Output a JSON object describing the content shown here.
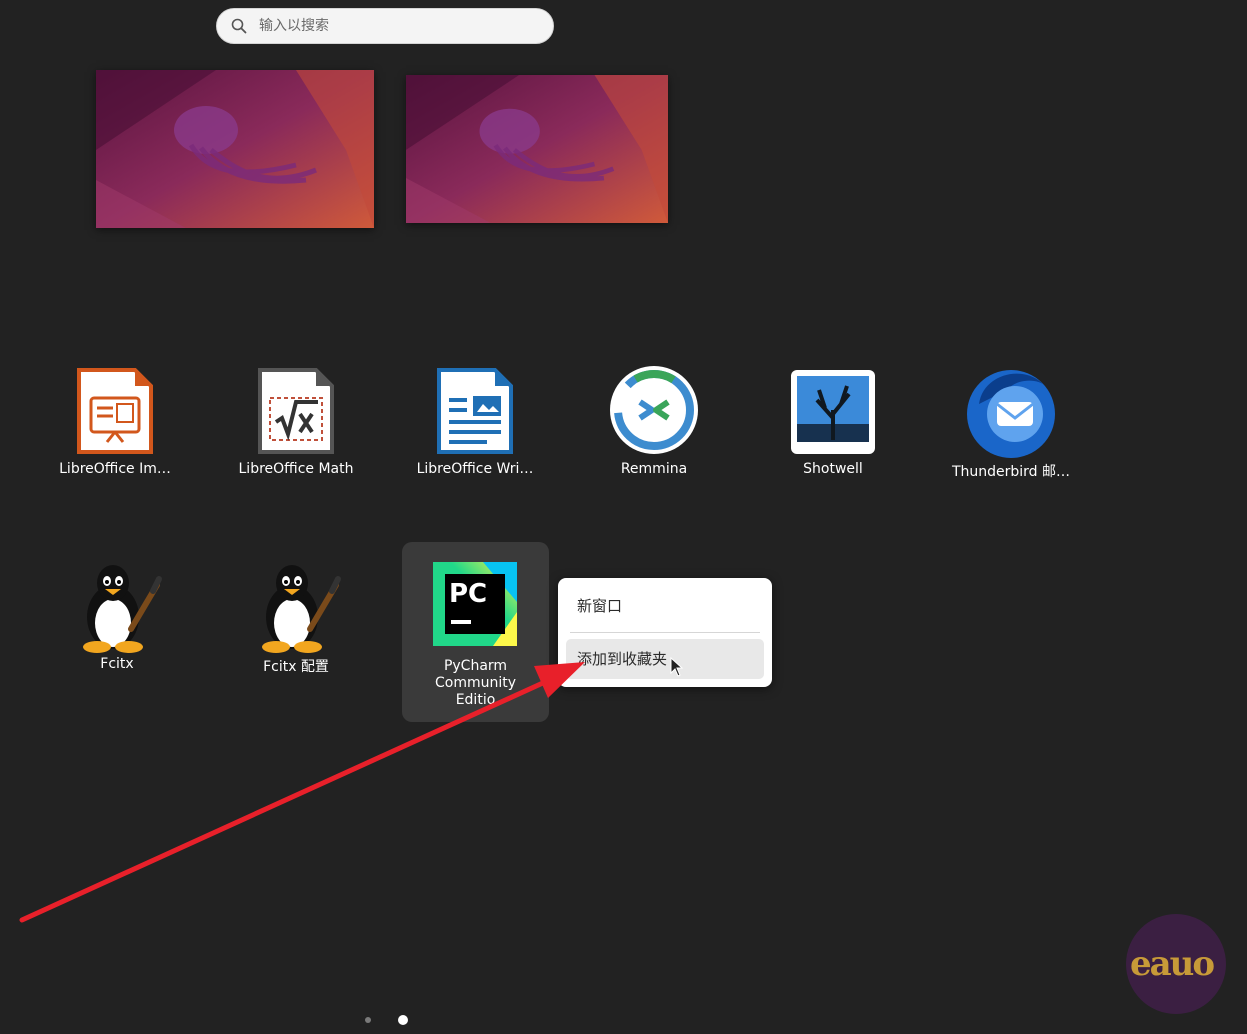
{
  "search": {
    "placeholder": "输入以搜索",
    "icon": "search-icon"
  },
  "workspaces": [
    {
      "name": "workspace-1"
    },
    {
      "name": "workspace-2"
    }
  ],
  "apps_row1": [
    {
      "label": "LibreOffice Im…",
      "icon": "libreoffice-impress-icon"
    },
    {
      "label": "LibreOffice Math",
      "icon": "libreoffice-math-icon"
    },
    {
      "label": "LibreOffice Wri…",
      "icon": "libreoffice-writer-icon"
    },
    {
      "label": "Remmina",
      "icon": "remmina-icon"
    },
    {
      "label": "Shotwell",
      "icon": "shotwell-icon"
    },
    {
      "label": "Thunderbird 邮…",
      "icon": "thunderbird-icon"
    }
  ],
  "apps_row2": [
    {
      "label": "Fcitx",
      "icon": "fcitx-penguin-icon"
    },
    {
      "label": "Fcitx 配置",
      "icon": "fcitx-config-penguin-icon"
    },
    {
      "label": "PyCharm\nCommunity\nEditio",
      "icon": "pycharm-icon",
      "icon_text": "PC"
    }
  ],
  "context_menu": {
    "items": [
      {
        "label": "新窗口"
      },
      {
        "label": "添加到收藏夹"
      }
    ]
  },
  "pager": {
    "pages": 2,
    "current": 2
  },
  "colors": {
    "background": "#222222",
    "annotation_arrow": "#e8202a",
    "menu_bg": "#ffffff",
    "tile_highlight": "#3a3a3a"
  },
  "watermark": {
    "text": "eauo"
  }
}
